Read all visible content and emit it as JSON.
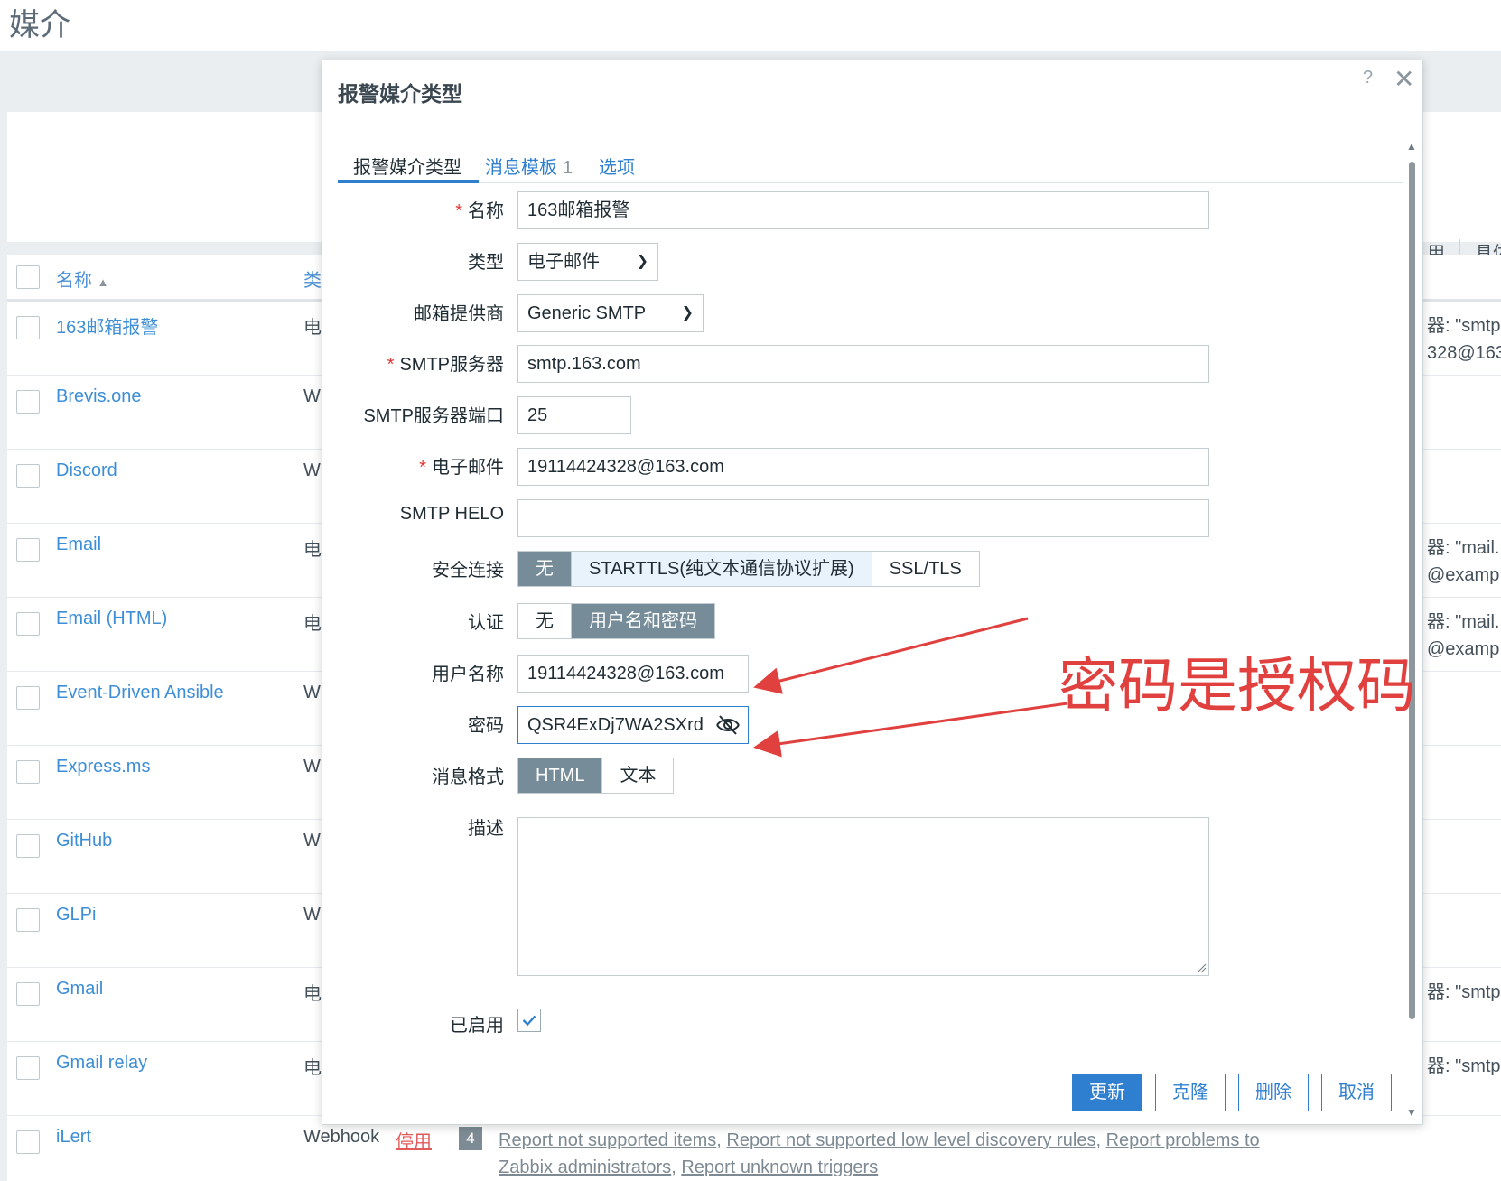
{
  "page": {
    "title": "媒介",
    "list_header": {
      "name": "名称",
      "type_abbrev": "类"
    },
    "right_header": {
      "col1": "用",
      "col2": "具体"
    },
    "rows": [
      {
        "name": "163邮箱报警",
        "type": "电",
        "desc1": "器: \"smtp",
        "desc2": "328@163"
      },
      {
        "name": "Brevis.one",
        "type": "W"
      },
      {
        "name": "Discord",
        "type": "W"
      },
      {
        "name": "Email",
        "type": "电",
        "desc1": "器: \"mail.",
        "desc2": "@examp"
      },
      {
        "name": "Email (HTML)",
        "type": "电",
        "desc1": "器: \"mail.",
        "desc2": "@examp"
      },
      {
        "name": "Event-Driven Ansible",
        "type": "W"
      },
      {
        "name": "Express.ms",
        "type": "W"
      },
      {
        "name": "GitHub",
        "type": "W"
      },
      {
        "name": "GLPi",
        "type": "W"
      },
      {
        "name": "Gmail",
        "type": "电",
        "desc1": "器: \"smtp"
      },
      {
        "name": "Gmail relay",
        "type": "电",
        "desc1": "器: \"smtp"
      },
      {
        "name": "iLert",
        "type": "Webhook",
        "status": "停用",
        "count": "4",
        "actions": [
          "Report not supported items",
          "Report not supported low level discovery rules",
          "Report problems to Zabbix administrators",
          "Report unknown triggers"
        ]
      }
    ]
  },
  "dialog": {
    "title": "报警媒介类型",
    "help": "?",
    "close": "✕",
    "tabs": [
      {
        "label": "报警媒介类型"
      },
      {
        "label": "消息模板",
        "count": "1"
      },
      {
        "label": "选项"
      }
    ],
    "fields": {
      "name": {
        "label": "名称",
        "value": "163邮箱报警"
      },
      "type": {
        "label": "类型",
        "value": "电子邮件"
      },
      "provider": {
        "label": "邮箱提供商",
        "value": "Generic SMTP"
      },
      "smtp_server": {
        "label": "SMTP服务器",
        "value": "smtp.163.com"
      },
      "smtp_port": {
        "label": "SMTP服务器端口",
        "value": "25"
      },
      "email": {
        "label": "电子邮件",
        "value": "19114424328@163.com"
      },
      "smtp_helo": {
        "label": "SMTP HELO",
        "value": ""
      },
      "security": {
        "label": "安全连接",
        "options": [
          "无",
          "STARTTLS(纯文本通信协议扩展)",
          "SSL/TLS"
        ],
        "selected": "无"
      },
      "auth": {
        "label": "认证",
        "options": [
          "无",
          "用户名和密码"
        ],
        "selected": "用户名和密码"
      },
      "username": {
        "label": "用户名称",
        "value": "19114424328@163.com"
      },
      "password": {
        "label": "密码",
        "value": "QSR4ExDj7WA2SXrd"
      },
      "message_format": {
        "label": "消息格式",
        "options": [
          "HTML",
          "文本"
        ],
        "selected": "HTML"
      },
      "description": {
        "label": "描述",
        "value": ""
      },
      "enabled": {
        "label": "已启用",
        "checked": true
      }
    },
    "buttons": {
      "update": "更新",
      "clone": "克隆",
      "delete": "删除",
      "cancel": "取消"
    }
  },
  "annotation": {
    "text": "密码是授权码",
    "color": "#e0403e"
  },
  "colors": {
    "link": "#2f7fd0",
    "selected_segment": "#768d99",
    "required": "#e33734"
  }
}
